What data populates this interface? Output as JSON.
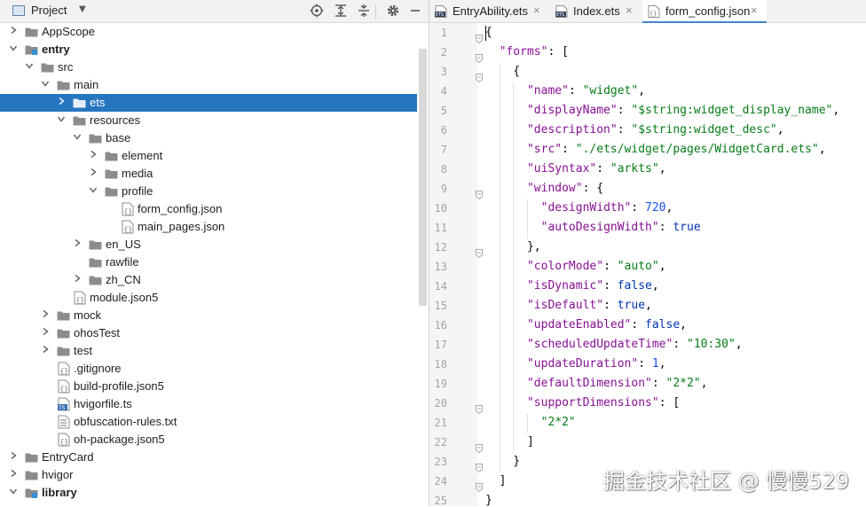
{
  "project_panel": {
    "title": "Project",
    "tree": [
      {
        "label": "AppScope",
        "depth": 0,
        "type": "folder",
        "arrow": "right",
        "bold": false
      },
      {
        "label": "entry",
        "depth": 0,
        "type": "module",
        "arrow": "down",
        "bold": true
      },
      {
        "label": "src",
        "depth": 1,
        "type": "folder",
        "arrow": "down",
        "bold": false
      },
      {
        "label": "main",
        "depth": 2,
        "type": "folder",
        "arrow": "down",
        "bold": false
      },
      {
        "label": "ets",
        "depth": 3,
        "type": "folder",
        "arrow": "right",
        "bold": false,
        "selected": true
      },
      {
        "label": "resources",
        "depth": 3,
        "type": "folder",
        "arrow": "down",
        "bold": false
      },
      {
        "label": "base",
        "depth": 4,
        "type": "folder",
        "arrow": "down",
        "bold": false
      },
      {
        "label": "element",
        "depth": 5,
        "type": "folder",
        "arrow": "right",
        "bold": false
      },
      {
        "label": "media",
        "depth": 5,
        "type": "folder",
        "arrow": "right",
        "bold": false
      },
      {
        "label": "profile",
        "depth": 5,
        "type": "folder",
        "arrow": "down",
        "bold": false
      },
      {
        "label": "form_config.json",
        "depth": 6,
        "type": "json",
        "arrow": "none",
        "bold": false
      },
      {
        "label": "main_pages.json",
        "depth": 6,
        "type": "json",
        "arrow": "none",
        "bold": false
      },
      {
        "label": "en_US",
        "depth": 4,
        "type": "folder",
        "arrow": "right",
        "bold": false
      },
      {
        "label": "rawfile",
        "depth": 4,
        "type": "folder",
        "arrow": "none",
        "bold": false
      },
      {
        "label": "zh_CN",
        "depth": 4,
        "type": "folder",
        "arrow": "right",
        "bold": false
      },
      {
        "label": "module.json5",
        "depth": 3,
        "type": "json",
        "arrow": "none",
        "bold": false
      },
      {
        "label": "mock",
        "depth": 2,
        "type": "folder",
        "arrow": "right",
        "bold": false
      },
      {
        "label": "ohosTest",
        "depth": 2,
        "type": "folder",
        "arrow": "right",
        "bold": false
      },
      {
        "label": "test",
        "depth": 2,
        "type": "folder",
        "arrow": "right",
        "bold": false
      },
      {
        "label": ".gitignore",
        "depth": 2,
        "type": "json",
        "arrow": "none",
        "bold": false
      },
      {
        "label": "build-profile.json5",
        "depth": 2,
        "type": "json",
        "arrow": "none",
        "bold": false
      },
      {
        "label": "hvigorfile.ts",
        "depth": 2,
        "type": "ts",
        "arrow": "none",
        "bold": false
      },
      {
        "label": "obfuscation-rules.txt",
        "depth": 2,
        "type": "txt",
        "arrow": "none",
        "bold": false
      },
      {
        "label": "oh-package.json5",
        "depth": 2,
        "type": "json",
        "arrow": "none",
        "bold": false
      },
      {
        "label": "EntryCard",
        "depth": 0,
        "type": "folder",
        "arrow": "right",
        "bold": false
      },
      {
        "label": "hvigor",
        "depth": 0,
        "type": "folder",
        "arrow": "right",
        "bold": false
      },
      {
        "label": "library",
        "depth": 0,
        "type": "module",
        "arrow": "down",
        "bold": true
      }
    ]
  },
  "editor": {
    "tabs": [
      {
        "label": "EntryAbility.ets",
        "icon": "ets-file-icon",
        "active": false
      },
      {
        "label": "Index.ets",
        "icon": "ets-file-icon",
        "active": false
      },
      {
        "label": "form_config.json",
        "icon": "json-file-icon",
        "active": true
      }
    ],
    "lines": [
      [
        [
          "p",
          "{"
        ]
      ],
      [
        [
          "p",
          "  "
        ],
        [
          "k",
          "\"forms\""
        ],
        [
          "p",
          ": ["
        ]
      ],
      [
        [
          "p",
          "    {"
        ]
      ],
      [
        [
          "p",
          "      "
        ],
        [
          "k",
          "\"name\""
        ],
        [
          "p",
          ": "
        ],
        [
          "s",
          "\"widget\""
        ],
        [
          "p",
          ","
        ]
      ],
      [
        [
          "p",
          "      "
        ],
        [
          "k",
          "\"displayName\""
        ],
        [
          "p",
          ": "
        ],
        [
          "s",
          "\"$string:widget_display_name\""
        ],
        [
          "p",
          ","
        ]
      ],
      [
        [
          "p",
          "      "
        ],
        [
          "k",
          "\"description\""
        ],
        [
          "p",
          ": "
        ],
        [
          "s",
          "\"$string:widget_desc\""
        ],
        [
          "p",
          ","
        ]
      ],
      [
        [
          "p",
          "      "
        ],
        [
          "k",
          "\"src\""
        ],
        [
          "p",
          ": "
        ],
        [
          "s",
          "\"./ets/widget/pages/WidgetCard.ets\""
        ],
        [
          "p",
          ","
        ]
      ],
      [
        [
          "p",
          "      "
        ],
        [
          "k",
          "\"uiSyntax\""
        ],
        [
          "p",
          ": "
        ],
        [
          "s",
          "\"arkts\""
        ],
        [
          "p",
          ","
        ]
      ],
      [
        [
          "p",
          "      "
        ],
        [
          "k",
          "\"window\""
        ],
        [
          "p",
          ": {"
        ]
      ],
      [
        [
          "p",
          "        "
        ],
        [
          "k",
          "\"designWidth\""
        ],
        [
          "p",
          ": "
        ],
        [
          "n",
          "720"
        ],
        [
          "p",
          ","
        ]
      ],
      [
        [
          "p",
          "        "
        ],
        [
          "k",
          "\"autoDesignWidth\""
        ],
        [
          "p",
          ": "
        ],
        [
          "b",
          "true"
        ]
      ],
      [
        [
          "p",
          "      },"
        ]
      ],
      [
        [
          "p",
          "      "
        ],
        [
          "k",
          "\"colorMode\""
        ],
        [
          "p",
          ": "
        ],
        [
          "s",
          "\"auto\""
        ],
        [
          "p",
          ","
        ]
      ],
      [
        [
          "p",
          "      "
        ],
        [
          "k",
          "\"isDynamic\""
        ],
        [
          "p",
          ": "
        ],
        [
          "b",
          "false"
        ],
        [
          "p",
          ","
        ]
      ],
      [
        [
          "p",
          "      "
        ],
        [
          "k",
          "\"isDefault\""
        ],
        [
          "p",
          ": "
        ],
        [
          "b",
          "true"
        ],
        [
          "p",
          ","
        ]
      ],
      [
        [
          "p",
          "      "
        ],
        [
          "k",
          "\"updateEnabled\""
        ],
        [
          "p",
          ": "
        ],
        [
          "b",
          "false"
        ],
        [
          "p",
          ","
        ]
      ],
      [
        [
          "p",
          "      "
        ],
        [
          "k",
          "\"scheduledUpdateTime\""
        ],
        [
          "p",
          ": "
        ],
        [
          "s",
          "\"10:30\""
        ],
        [
          "p",
          ","
        ]
      ],
      [
        [
          "p",
          "      "
        ],
        [
          "k",
          "\"updateDuration\""
        ],
        [
          "p",
          ": "
        ],
        [
          "n",
          "1"
        ],
        [
          "p",
          ","
        ]
      ],
      [
        [
          "p",
          "      "
        ],
        [
          "k",
          "\"defaultDimension\""
        ],
        [
          "p",
          ": "
        ],
        [
          "s",
          "\"2*2\""
        ],
        [
          "p",
          ","
        ]
      ],
      [
        [
          "p",
          "      "
        ],
        [
          "k",
          "\"supportDimensions\""
        ],
        [
          "p",
          ": ["
        ]
      ],
      [
        [
          "p",
          "        "
        ],
        [
          "s",
          "\"2*2\""
        ]
      ],
      [
        [
          "p",
          "      ]"
        ]
      ],
      [
        [
          "p",
          "    }"
        ]
      ],
      [
        [
          "p",
          "  ]"
        ]
      ],
      [
        [
          "p",
          "}"
        ]
      ]
    ],
    "fold_lines": [
      1,
      2,
      3,
      9,
      12,
      20,
      22,
      23,
      24
    ]
  },
  "watermark": "掘金技术社区 @ 慢慢529",
  "colors": {
    "selection": "#2675bf",
    "key": "#871094",
    "string": "#067d17",
    "number": "#1750eb",
    "keyword": "#0033b3"
  }
}
